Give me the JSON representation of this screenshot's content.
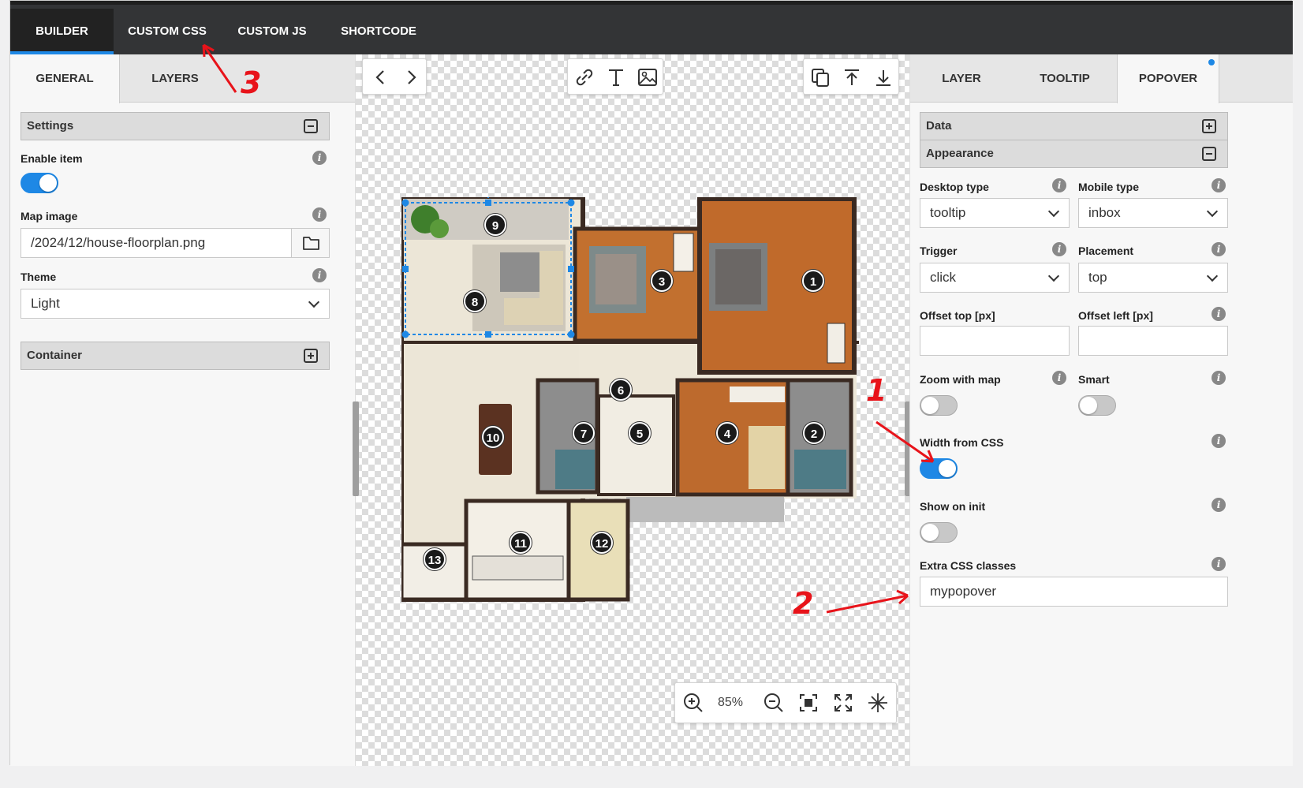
{
  "top_tabs": [
    "BUILDER",
    "CUSTOM CSS",
    "CUSTOM JS",
    "SHORTCODE"
  ],
  "left": {
    "tabs": [
      "GENERAL",
      "LAYERS"
    ],
    "settings_title": "Settings",
    "enable_item_label": "Enable item",
    "enable_item_on": true,
    "map_image_label": "Map image",
    "map_image_value": "/2024/12/house-floorplan.png",
    "theme_label": "Theme",
    "theme_value": "Light",
    "container_title": "Container"
  },
  "canvas": {
    "zoom": "85%",
    "markers": [
      "1",
      "2",
      "3",
      "4",
      "5",
      "6",
      "7",
      "8",
      "9",
      "10",
      "11",
      "12",
      "13"
    ]
  },
  "right": {
    "tabs": [
      "LAYER",
      "TOOLTIP",
      "POPOVER"
    ],
    "data_title": "Data",
    "appearance_title": "Appearance",
    "desktop_type_label": "Desktop type",
    "desktop_type_value": "tooltip",
    "mobile_type_label": "Mobile type",
    "mobile_type_value": "inbox",
    "trigger_label": "Trigger",
    "trigger_value": "click",
    "placement_label": "Placement",
    "placement_value": "top",
    "offset_top_label": "Offset top [px]",
    "offset_top_value": "",
    "offset_left_label": "Offset left [px]",
    "offset_left_value": "",
    "zoom_with_map_label": "Zoom with map",
    "smart_label": "Smart",
    "width_from_css_label": "Width from CSS",
    "show_on_init_label": "Show on init",
    "extra_css_label": "Extra CSS classes",
    "extra_css_value": "mypopover"
  },
  "annotations": [
    "1",
    "2",
    "3"
  ],
  "colors": {
    "accent": "#1e88e5",
    "annotation": "#e8131a",
    "topbar": "#333436"
  }
}
